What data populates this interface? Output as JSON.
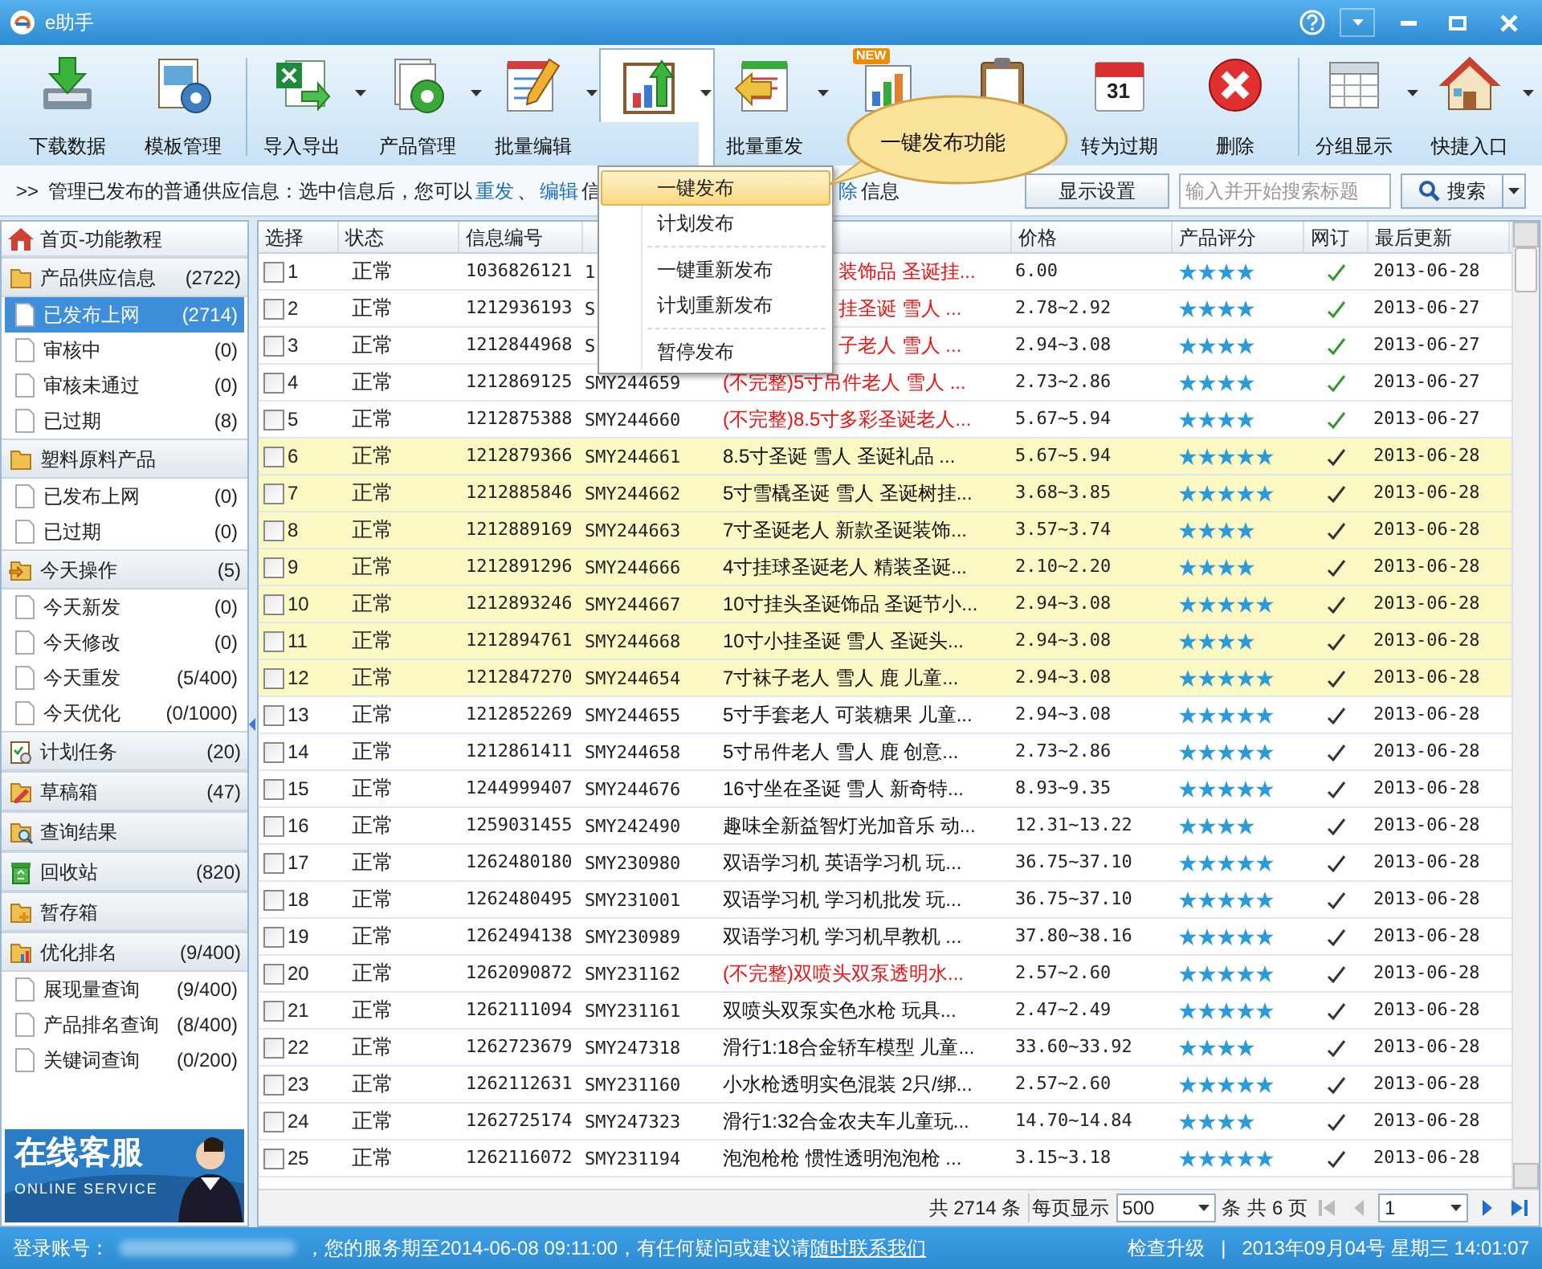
{
  "window": {
    "title": "e助手"
  },
  "toolbar": [
    {
      "kind": "download",
      "label": "下载数据",
      "dropdown": false,
      "selected": false
    },
    {
      "kind": "template",
      "label": "模板管理",
      "dropdown": false,
      "selected": false
    },
    {
      "kind": "separator"
    },
    {
      "kind": "excel",
      "label": "导入导出",
      "dropdown": true,
      "selected": false
    },
    {
      "kind": "docgear",
      "label": "产品管理",
      "dropdown": true,
      "selected": false
    },
    {
      "kind": "notepad",
      "label": "批量编辑",
      "dropdown": true,
      "selected": false
    },
    {
      "kind": "chartup",
      "dropdown": true,
      "selected": true
    },
    {
      "kind": "return",
      "label": "批量重发",
      "dropdown": true,
      "selected": false
    },
    {
      "kind": "chartnew",
      "badge": "NEW",
      "dropdown": false,
      "selected": false
    },
    {
      "kind": "clipboard",
      "dropdown": false,
      "selected": false
    },
    {
      "kind": "calendar",
      "icon_text": "31",
      "label": "转为过期",
      "dropdown": false,
      "selected": false
    },
    {
      "kind": "delete",
      "label": "删除",
      "dropdown": false,
      "selected": false
    },
    {
      "kind": "separator"
    },
    {
      "kind": "grid",
      "label": "分组显示",
      "dropdown": true,
      "selected": false
    },
    {
      "kind": "house",
      "label": "快捷入口",
      "dropdown": true,
      "selected": false
    }
  ],
  "info_bar": {
    "prefix": ">>",
    "before_menu": [
      {
        "kind": "text",
        "text": "管理已发布的普通供应信息：选中信息后，您可以"
      },
      {
        "kind": "link",
        "text": "重发"
      },
      {
        "kind": "text",
        "text": "、"
      },
      {
        "kind": "link",
        "text": "编辑"
      },
      {
        "kind": "text",
        "text": "信"
      }
    ],
    "after_menu": [
      {
        "kind": "link",
        "text": "除"
      },
      {
        "kind": "text",
        "text": "信息"
      }
    ],
    "settings_button": "显示设置",
    "search": {
      "placeholder": "输入并开始搜索标题",
      "button": "搜索"
    }
  },
  "sidebar": {
    "items": [
      {
        "kind": "home",
        "label": "首页-功能教程",
        "selected": false
      },
      {
        "kind": "folder",
        "label": "产品供应信息",
        "count": "(2722)",
        "selected": false
      },
      {
        "kind": "item",
        "label": "已发布上网",
        "count": "(2714)",
        "selected": true
      },
      {
        "kind": "item",
        "label": "审核中",
        "count": "(0)",
        "selected": false
      },
      {
        "kind": "item",
        "label": "审核未通过",
        "count": "(0)",
        "selected": false
      },
      {
        "kind": "item",
        "label": "已过期",
        "count": "(8)",
        "selected": false
      },
      {
        "kind": "folder",
        "label": "塑料原料产品",
        "selected": false
      },
      {
        "kind": "item",
        "label": "已发布上网",
        "count": "(0)",
        "selected": false
      },
      {
        "kind": "item",
        "label": "已过期",
        "count": "(0)",
        "selected": false
      },
      {
        "kind": "folder-in",
        "label": "今天操作",
        "count": "(5)",
        "selected": false
      },
      {
        "kind": "item",
        "label": "今天新发",
        "count": "(0)",
        "selected": false
      },
      {
        "kind": "item",
        "label": "今天修改",
        "count": "(0)",
        "selected": false
      },
      {
        "kind": "item",
        "label": "今天重发",
        "count": "(5/400)",
        "selected": false
      },
      {
        "kind": "item",
        "label": "今天优化",
        "count": "(0/1000)",
        "selected": false
      },
      {
        "kind": "tasks",
        "label": "计划任务",
        "count": "(20)",
        "selected": false
      },
      {
        "kind": "draft",
        "label": "草稿箱",
        "count": "(47)",
        "selected": false
      },
      {
        "kind": "search",
        "label": "查询结果",
        "selected": false
      },
      {
        "kind": "recycle",
        "label": "回收站",
        "count": "(820)",
        "selected": false
      },
      {
        "kind": "plus",
        "label": "暂存箱",
        "selected": false
      },
      {
        "kind": "chart",
        "label": "优化排名",
        "count": "(9/400)",
        "selected": false
      },
      {
        "kind": "item",
        "label": "展现量查询",
        "count": "(9/400)",
        "selected": false
      },
      {
        "kind": "item",
        "label": "产品排名查询",
        "count": "(8/400)",
        "selected": false
      },
      {
        "kind": "item",
        "label": "关键词查询",
        "count": "(0/200)",
        "selected": false
      }
    ]
  },
  "banner": {
    "title": "在线客服",
    "subtitle": "ONLINE SERVICE"
  },
  "dropdown_menu": {
    "items": [
      {
        "kind": "item",
        "label": "一键发布",
        "selected": true
      },
      {
        "kind": "item",
        "label": "计划发布",
        "selected": false
      },
      {
        "kind": "separator"
      },
      {
        "kind": "item",
        "label": "一键重新发布",
        "selected": false
      },
      {
        "kind": "item",
        "label": "计划重新发布",
        "selected": false
      },
      {
        "kind": "separator"
      },
      {
        "kind": "item",
        "label": "暂停发布",
        "selected": false
      }
    ]
  },
  "callout": {
    "text": "一键发布功能"
  },
  "table": {
    "columns": [
      {
        "label": "选择"
      },
      {
        "label": "状态"
      },
      {
        "label": "信息编号"
      },
      {},
      {},
      {
        "label": "价格"
      },
      {
        "label": "产品评分"
      },
      {
        "label": "网订"
      },
      {
        "label": "最后更新"
      }
    ],
    "rows": [
      {
        "checked": false,
        "no": "1",
        "status": "正常",
        "id": "1036826121",
        "code": "1",
        "title": "装饰品 圣诞挂...",
        "title_cut": true,
        "warning": true,
        "highlighted": false,
        "price": "6.00",
        "stars": 4,
        "color": "#2e9a2e",
        "updated": "2013-06-28"
      },
      {
        "checked": false,
        "no": "2",
        "status": "正常",
        "id": "1212936193",
        "code": "S",
        "title": "挂圣诞 雪人 ...",
        "title_cut": true,
        "warning": true,
        "highlighted": false,
        "price": "2.78~2.92",
        "stars": 4,
        "color": "#2e9a2e",
        "updated": "2013-06-27"
      },
      {
        "checked": false,
        "no": "3",
        "status": "正常",
        "id": "1212844968",
        "code": "S",
        "title": "子老人 雪人 ...",
        "title_cut": true,
        "warning": true,
        "highlighted": false,
        "price": "2.94~3.08",
        "stars": 4,
        "color": "#2e9a2e",
        "updated": "2013-06-27"
      },
      {
        "checked": false,
        "no": "4",
        "status": "正常",
        "id": "1212869125",
        "code": "SMY244659",
        "title": "(不完整)5寸吊件老人 雪人 ...",
        "title_cut": false,
        "warning": true,
        "highlighted": false,
        "price": "2.73~2.86",
        "stars": 4,
        "color": "#2e9a2e",
        "updated": "2013-06-27"
      },
      {
        "checked": false,
        "no": "5",
        "status": "正常",
        "id": "1212875388",
        "code": "SMY244660",
        "title": "(不完整)8.5寸多彩圣诞老人...",
        "title_cut": false,
        "warning": true,
        "highlighted": false,
        "price": "5.67~5.94",
        "stars": 4,
        "color": "#2e9a2e",
        "updated": "2013-06-27"
      },
      {
        "checked": false,
        "no": "6",
        "status": "正常",
        "id": "1212879366",
        "code": "SMY244661",
        "title": "8.5寸圣诞 雪人 圣诞礼品 ...",
        "title_cut": false,
        "warning": false,
        "highlighted": true,
        "price": "5.67~5.94",
        "stars": 5,
        "color": "#333333",
        "updated": "2013-06-28"
      },
      {
        "checked": false,
        "no": "7",
        "status": "正常",
        "id": "1212885846",
        "code": "SMY244662",
        "title": "5寸雪橇圣诞 雪人 圣诞树挂...",
        "title_cut": false,
        "warning": false,
        "highlighted": true,
        "price": "3.68~3.85",
        "stars": 5,
        "color": "#333333",
        "updated": "2013-06-28"
      },
      {
        "checked": false,
        "no": "8",
        "status": "正常",
        "id": "1212889169",
        "code": "SMY244663",
        "title": "7寸圣诞老人 新款圣诞装饰...",
        "title_cut": false,
        "warning": false,
        "highlighted": true,
        "price": "3.57~3.74",
        "stars": 4,
        "color": "#333333",
        "updated": "2013-06-28"
      },
      {
        "checked": false,
        "no": "9",
        "status": "正常",
        "id": "1212891296",
        "code": "SMY244666",
        "title": "4寸挂球圣诞老人 精装圣诞...",
        "title_cut": false,
        "warning": false,
        "highlighted": true,
        "price": "2.10~2.20",
        "stars": 4,
        "color": "#333333",
        "updated": "2013-06-28"
      },
      {
        "checked": false,
        "no": "10",
        "status": "正常",
        "id": "1212893246",
        "code": "SMY244667",
        "title": "10寸挂头圣诞饰品 圣诞节小...",
        "title_cut": false,
        "warning": false,
        "highlighted": true,
        "price": "2.94~3.08",
        "stars": 5,
        "color": "#333333",
        "updated": "2013-06-28"
      },
      {
        "checked": false,
        "no": "11",
        "status": "正常",
        "id": "1212894761",
        "code": "SMY244668",
        "title": "10寸小挂圣诞 雪人 圣诞头...",
        "title_cut": false,
        "warning": false,
        "highlighted": true,
        "price": "2.94~3.08",
        "stars": 4,
        "color": "#333333",
        "updated": "2013-06-28"
      },
      {
        "checked": false,
        "no": "12",
        "status": "正常",
        "id": "1212847270",
        "code": "SMY244654",
        "title": "7寸袜子老人 雪人 鹿 儿童...",
        "title_cut": false,
        "warning": false,
        "highlighted": true,
        "price": "2.94~3.08",
        "stars": 5,
        "color": "#333333",
        "updated": "2013-06-28"
      },
      {
        "checked": false,
        "no": "13",
        "status": "正常",
        "id": "1212852269",
        "code": "SMY244655",
        "title": "5寸手套老人 可装糖果 儿童...",
        "title_cut": false,
        "warning": false,
        "highlighted": false,
        "price": "2.94~3.08",
        "stars": 5,
        "color": "#333333",
        "updated": "2013-06-28"
      },
      {
        "checked": false,
        "no": "14",
        "status": "正常",
        "id": "1212861411",
        "code": "SMY244658",
        "title": "5寸吊件老人 雪人 鹿 创意...",
        "title_cut": false,
        "warning": false,
        "highlighted": false,
        "price": "2.73~2.86",
        "stars": 5,
        "color": "#333333",
        "updated": "2013-06-28"
      },
      {
        "checked": false,
        "no": "15",
        "status": "正常",
        "id": "1244999407",
        "code": "SMY244676",
        "title": "16寸坐在圣诞 雪人 新奇特...",
        "title_cut": false,
        "warning": false,
        "highlighted": false,
        "price": "8.93~9.35",
        "stars": 5,
        "color": "#333333",
        "updated": "2013-06-28"
      },
      {
        "checked": false,
        "no": "16",
        "status": "正常",
        "id": "1259031455",
        "code": "SMY242490",
        "title": "趣味全新益智灯光加音乐 动...",
        "title_cut": false,
        "warning": false,
        "highlighted": false,
        "price": "12.31~13.22",
        "stars": 4,
        "color": "#333333",
        "updated": "2013-06-28"
      },
      {
        "checked": false,
        "no": "17",
        "status": "正常",
        "id": "1262480180",
        "code": "SMY230980",
        "title": "双语学习机 英语学习机 玩...",
        "title_cut": false,
        "warning": false,
        "highlighted": false,
        "price": "36.75~37.10",
        "stars": 5,
        "color": "#333333",
        "updated": "2013-06-28"
      },
      {
        "checked": false,
        "no": "18",
        "status": "正常",
        "id": "1262480495",
        "code": "SMY231001",
        "title": "双语学习机 学习机批发 玩...",
        "title_cut": false,
        "warning": false,
        "highlighted": false,
        "price": "36.75~37.10",
        "stars": 5,
        "color": "#333333",
        "updated": "2013-06-28"
      },
      {
        "checked": false,
        "no": "19",
        "status": "正常",
        "id": "1262494138",
        "code": "SMY230989",
        "title": "双语学习机 学习机早教机 ...",
        "title_cut": false,
        "warning": false,
        "highlighted": false,
        "price": "37.80~38.16",
        "stars": 5,
        "color": "#333333",
        "updated": "2013-06-28"
      },
      {
        "checked": false,
        "no": "20",
        "status": "正常",
        "id": "1262090872",
        "code": "SMY231162",
        "title": "(不完整)双喷头双泵透明水...",
        "title_cut": false,
        "warning": true,
        "highlighted": false,
        "price": "2.57~2.60",
        "stars": 5,
        "color": "#333333",
        "updated": "2013-06-28"
      },
      {
        "checked": false,
        "no": "21",
        "status": "正常",
        "id": "1262111094",
        "code": "SMY231161",
        "title": "双喷头双泵实色水枪  玩具...",
        "title_cut": false,
        "warning": false,
        "highlighted": false,
        "price": "2.47~2.49",
        "stars": 5,
        "color": "#333333",
        "updated": "2013-06-28"
      },
      {
        "checked": false,
        "no": "22",
        "status": "正常",
        "id": "1262723679",
        "code": "SMY247318",
        "title": "滑行1:18合金轿车模型 儿童...",
        "title_cut": false,
        "warning": false,
        "highlighted": false,
        "price": "33.60~33.92",
        "stars": 4,
        "color": "#333333",
        "updated": "2013-06-28"
      },
      {
        "checked": false,
        "no": "23",
        "status": "正常",
        "id": "1262112631",
        "code": "SMY231160",
        "title": "小水枪透明实色混装 2只/绑...",
        "title_cut": false,
        "warning": false,
        "highlighted": false,
        "price": "2.57~2.60",
        "stars": 5,
        "color": "#333333",
        "updated": "2013-06-28"
      },
      {
        "checked": false,
        "no": "24",
        "status": "正常",
        "id": "1262725174",
        "code": "SMY247323",
        "title": "滑行1:32合金农夫车儿童玩...",
        "title_cut": false,
        "warning": false,
        "highlighted": false,
        "price": "14.70~14.84",
        "stars": 4,
        "color": "#333333",
        "updated": "2013-06-28"
      },
      {
        "checked": false,
        "no": "25",
        "status": "正常",
        "id": "1262116072",
        "code": "SMY231194",
        "title": "泡泡枪枪 惯性透明泡泡枪 ...",
        "title_cut": false,
        "warning": false,
        "highlighted": false,
        "price": "3.15~3.18",
        "stars": 5,
        "color": "#333333",
        "updated": "2013-06-28"
      }
    ]
  },
  "pagination": {
    "total": "共 2714 条",
    "per_page_label": "每页显示",
    "per_page": "500",
    "per_page_unit": "条",
    "pages": "共 6 页",
    "page": "1"
  },
  "status_bar": {
    "account_label": "登录账号：",
    "message": "，您的服务期至2014-06-08 09:11:00，有任何疑问或建议请",
    "contact_link": "随时联系我们",
    "upgrade": "检查升级",
    "divider": "|",
    "datetime": "2013年09月04号 星期三 14:01:07"
  }
}
